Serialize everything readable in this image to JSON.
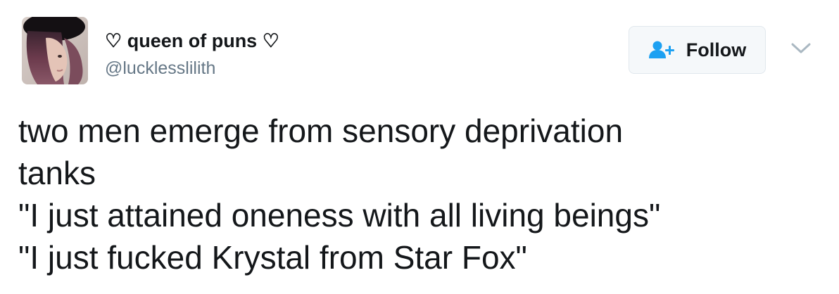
{
  "tweet": {
    "author": {
      "display_name": "♡ queen of puns ♡",
      "handle": "@lucklesslilith"
    },
    "follow_label": "Follow",
    "text_lines": [
      "two men emerge from sensory deprivation",
      "tanks",
      "\"I just attained oneness with all living beings\"",
      "\"I just fucked Krystal from Star Fox\""
    ]
  },
  "icons": {
    "follow": "add-user-icon",
    "menu": "chevron-down-icon"
  },
  "colors": {
    "accent": "#1da1f2",
    "text": "#14171a",
    "secondary_text": "#657786",
    "button_border": "#e1e8ed",
    "button_bg": "#f5f8fa"
  }
}
